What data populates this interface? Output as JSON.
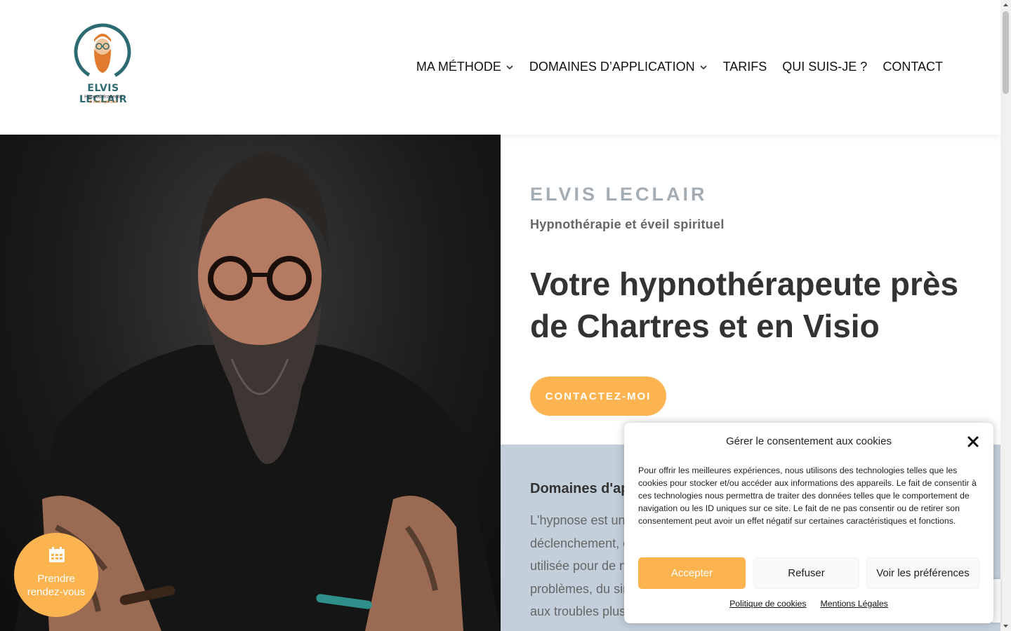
{
  "logo": {
    "name": "ELVIS LECLAIR",
    "subtitle": "Hypnothérapeute",
    "subtitle2": "& éveil spirituel"
  },
  "nav": {
    "items": [
      {
        "label": "MA MÉTHODE",
        "has_dropdown": true
      },
      {
        "label": "DOMAINES D’APPLICATION",
        "has_dropdown": true
      },
      {
        "label": "TARIFS",
        "has_dropdown": false
      },
      {
        "label": "QUI SUIS-JE ?",
        "has_dropdown": false
      },
      {
        "label": "CONTACT",
        "has_dropdown": false
      }
    ]
  },
  "hero": {
    "eyebrow": "ELVIS LECLAIR",
    "tagline": "Hypnothérapie et éveil spirituel",
    "headline": "Votre hypnothérapeute près de Chartres et en Visio",
    "cta_label": "CONTACTEZ-MOI"
  },
  "domains": {
    "title": "Domaines d'app",
    "lines": [
      "L'hypnose est un e",
      "déclenchement, c",
      "utilisée pour de n",
      "problèmes, du sin",
      "aux troubles plus"
    ]
  },
  "appointment": {
    "label_line1": "Prendre",
    "label_line2": "rendez-vous",
    "icon": "calendar-icon"
  },
  "cookie": {
    "title": "Gérer le consentement aux cookies",
    "text": "Pour offrir les meilleures expériences, nous utilisons des technologies telles que les cookies pour stocker et/ou accéder aux informations des appareils. Le fait de consentir à ces technologies nous permettra de traiter des données telles que le comportement de navigation ou les ID uniques sur ce site. Le fait de ne pas consentir ou de retirer son consentement peut avoir un effet négatif sur certaines caractéristiques et fonctions.",
    "accept_label": "Accepter",
    "refuse_label": "Refuser",
    "prefs_label": "Voir les préférences",
    "policy_link": "Politique de cookies",
    "legal_link": "Mentions Légales"
  },
  "colors": {
    "accent": "#fbb450",
    "domains_bg": "#c3d0dc",
    "eyebrow": "#a3adb3",
    "logo_teal": "#2d6b72",
    "logo_orange": "#e07a2e"
  }
}
